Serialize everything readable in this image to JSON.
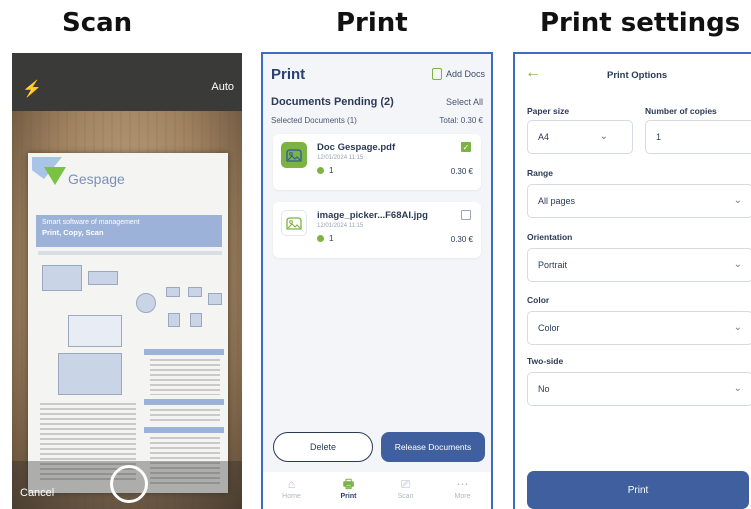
{
  "headings": {
    "scan": "Scan",
    "print": "Print",
    "settings": "Print settings"
  },
  "scan": {
    "flash_icon": "bolt-icon",
    "auto_label": "Auto",
    "cancel_label": "Cancel",
    "document": {
      "brand": "Gespage",
      "banner_line1": "Smart software of management",
      "banner_line2": "Print, Copy, Scan"
    }
  },
  "print": {
    "title": "Print",
    "add_docs": "Add Docs",
    "pending": "Documents Pending (2)",
    "select_all": "Select All",
    "selected_docs": "Selected Documents (1)",
    "total": "Total: 0.30 €",
    "documents": [
      {
        "name": "Doc Gespage.pdf",
        "meta": "12/01/2024 11:15",
        "copies": "1",
        "price": "0.30 €",
        "selected": true,
        "icon": "image-icon",
        "thumb_color": "#7cb342"
      },
      {
        "name": "image_picker...F68AI.jpg",
        "meta": "12/01/2024 11:15",
        "copies": "1",
        "price": "0.30 €",
        "selected": false,
        "icon": "image-icon",
        "thumb_color": "#ffffff"
      }
    ],
    "delete_label": "Delete",
    "release_label": "Release Documents",
    "nav": [
      {
        "label": "Home",
        "icon": "home-icon",
        "active": false
      },
      {
        "label": "Print",
        "icon": "printer-icon",
        "active": true
      },
      {
        "label": "Scan",
        "icon": "scan-icon",
        "active": false
      },
      {
        "label": "More",
        "icon": "more-icon",
        "active": false
      }
    ]
  },
  "settings": {
    "title": "Print Options",
    "paper_size_label": "Paper size",
    "paper_size_value": "A4",
    "copies_label": "Number of copies",
    "copies_value": "1",
    "range_label": "Range",
    "range_value": "All pages",
    "orientation_label": "Orientation",
    "orientation_value": "Portrait",
    "color_label": "Color",
    "color_value": "Color",
    "two_side_label": "Two-side",
    "two_side_value": "No",
    "print_label": "Print"
  },
  "colors": {
    "accent": "#3f5f9e",
    "green": "#7cb342",
    "frame": "#3c6cc4"
  }
}
